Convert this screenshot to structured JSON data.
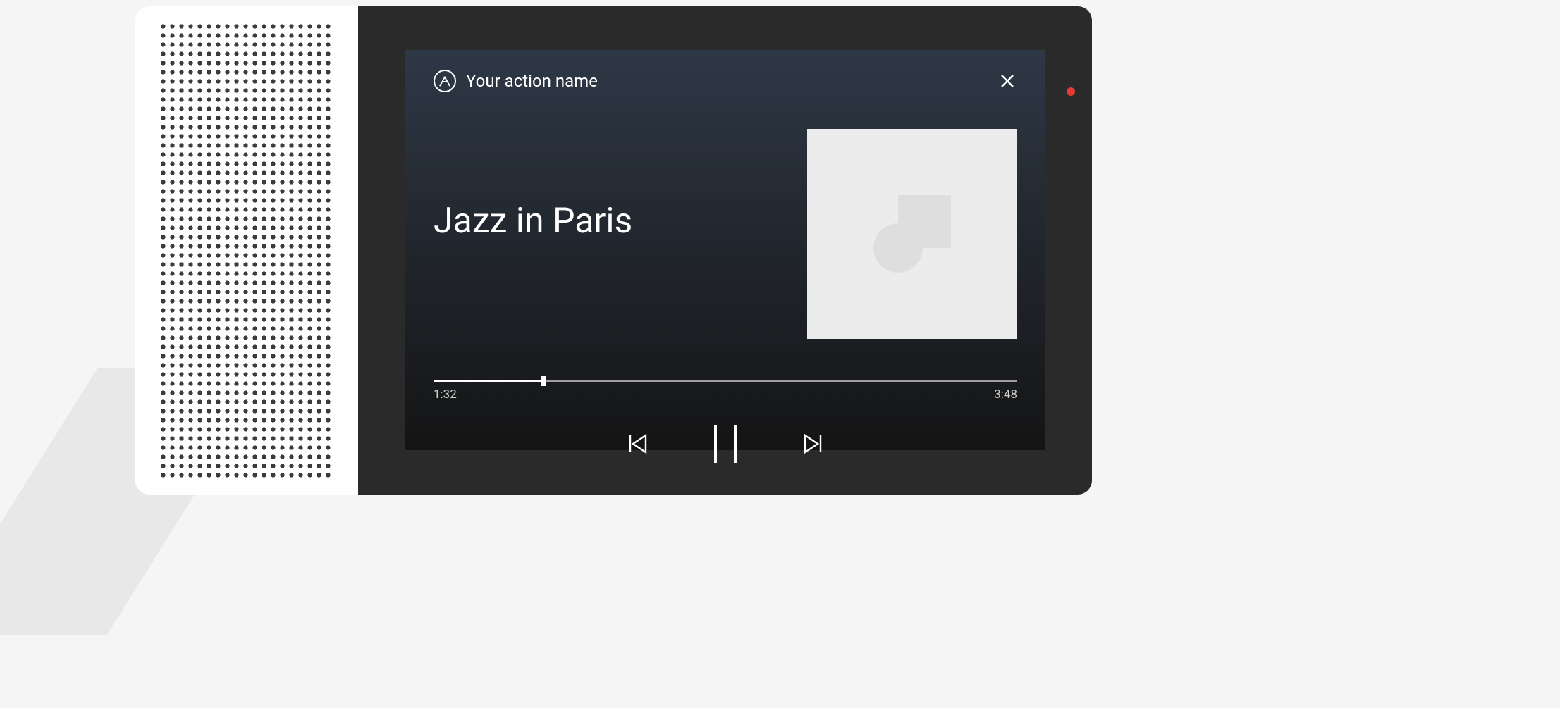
{
  "header": {
    "action_name": "Your action name",
    "icon_name": "action-logo-icon",
    "close_icon": "close-icon"
  },
  "media": {
    "track_title": "Jazz in Paris",
    "album_art_placeholder": "image-placeholder-icon",
    "progress": {
      "elapsed": "1:32",
      "duration": "3:48",
      "percent": 18.8
    },
    "controls": {
      "previous_icon": "skip-previous-icon",
      "play_pause_icon": "pause-icon",
      "next_icon": "skip-next-icon"
    }
  },
  "device": {
    "mic_muted_indicator": "mic-muted-indicator"
  }
}
